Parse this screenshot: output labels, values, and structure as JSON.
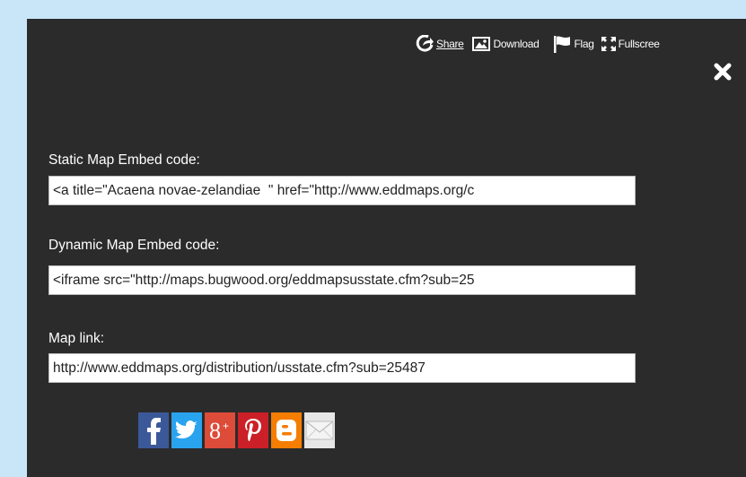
{
  "toolbar": {
    "share_label": "Share",
    "download_label": "Download",
    "flag_label": "Flag",
    "fullscreen_label": "Fullscree"
  },
  "embed": {
    "static_label": "Static Map Embed code:",
    "static_value": "<a title=\"Acaena novae-zelandiae  \" href=\"http://www.eddmaps.org/c",
    "dynamic_label": "Dynamic Map Embed code:",
    "dynamic_value": "<iframe src=\"http://maps.bugwood.org/eddmapsusstate.cfm?sub=25",
    "link_label": "Map link:",
    "link_value": "http://www.eddmaps.org/distribution/usstate.cfm?sub=25487"
  },
  "social": [
    {
      "icon": "facebook-icon",
      "color": "#3b5998"
    },
    {
      "icon": "twitter-icon",
      "color": "#2aa3ef"
    },
    {
      "icon": "google-plus-icon",
      "color": "#dd4b39"
    },
    {
      "icon": "pinterest-icon",
      "color": "#cb2027"
    },
    {
      "icon": "blogger-icon",
      "color": "#f57d00"
    },
    {
      "icon": "email-icon",
      "color": "#e6e6e6"
    }
  ]
}
